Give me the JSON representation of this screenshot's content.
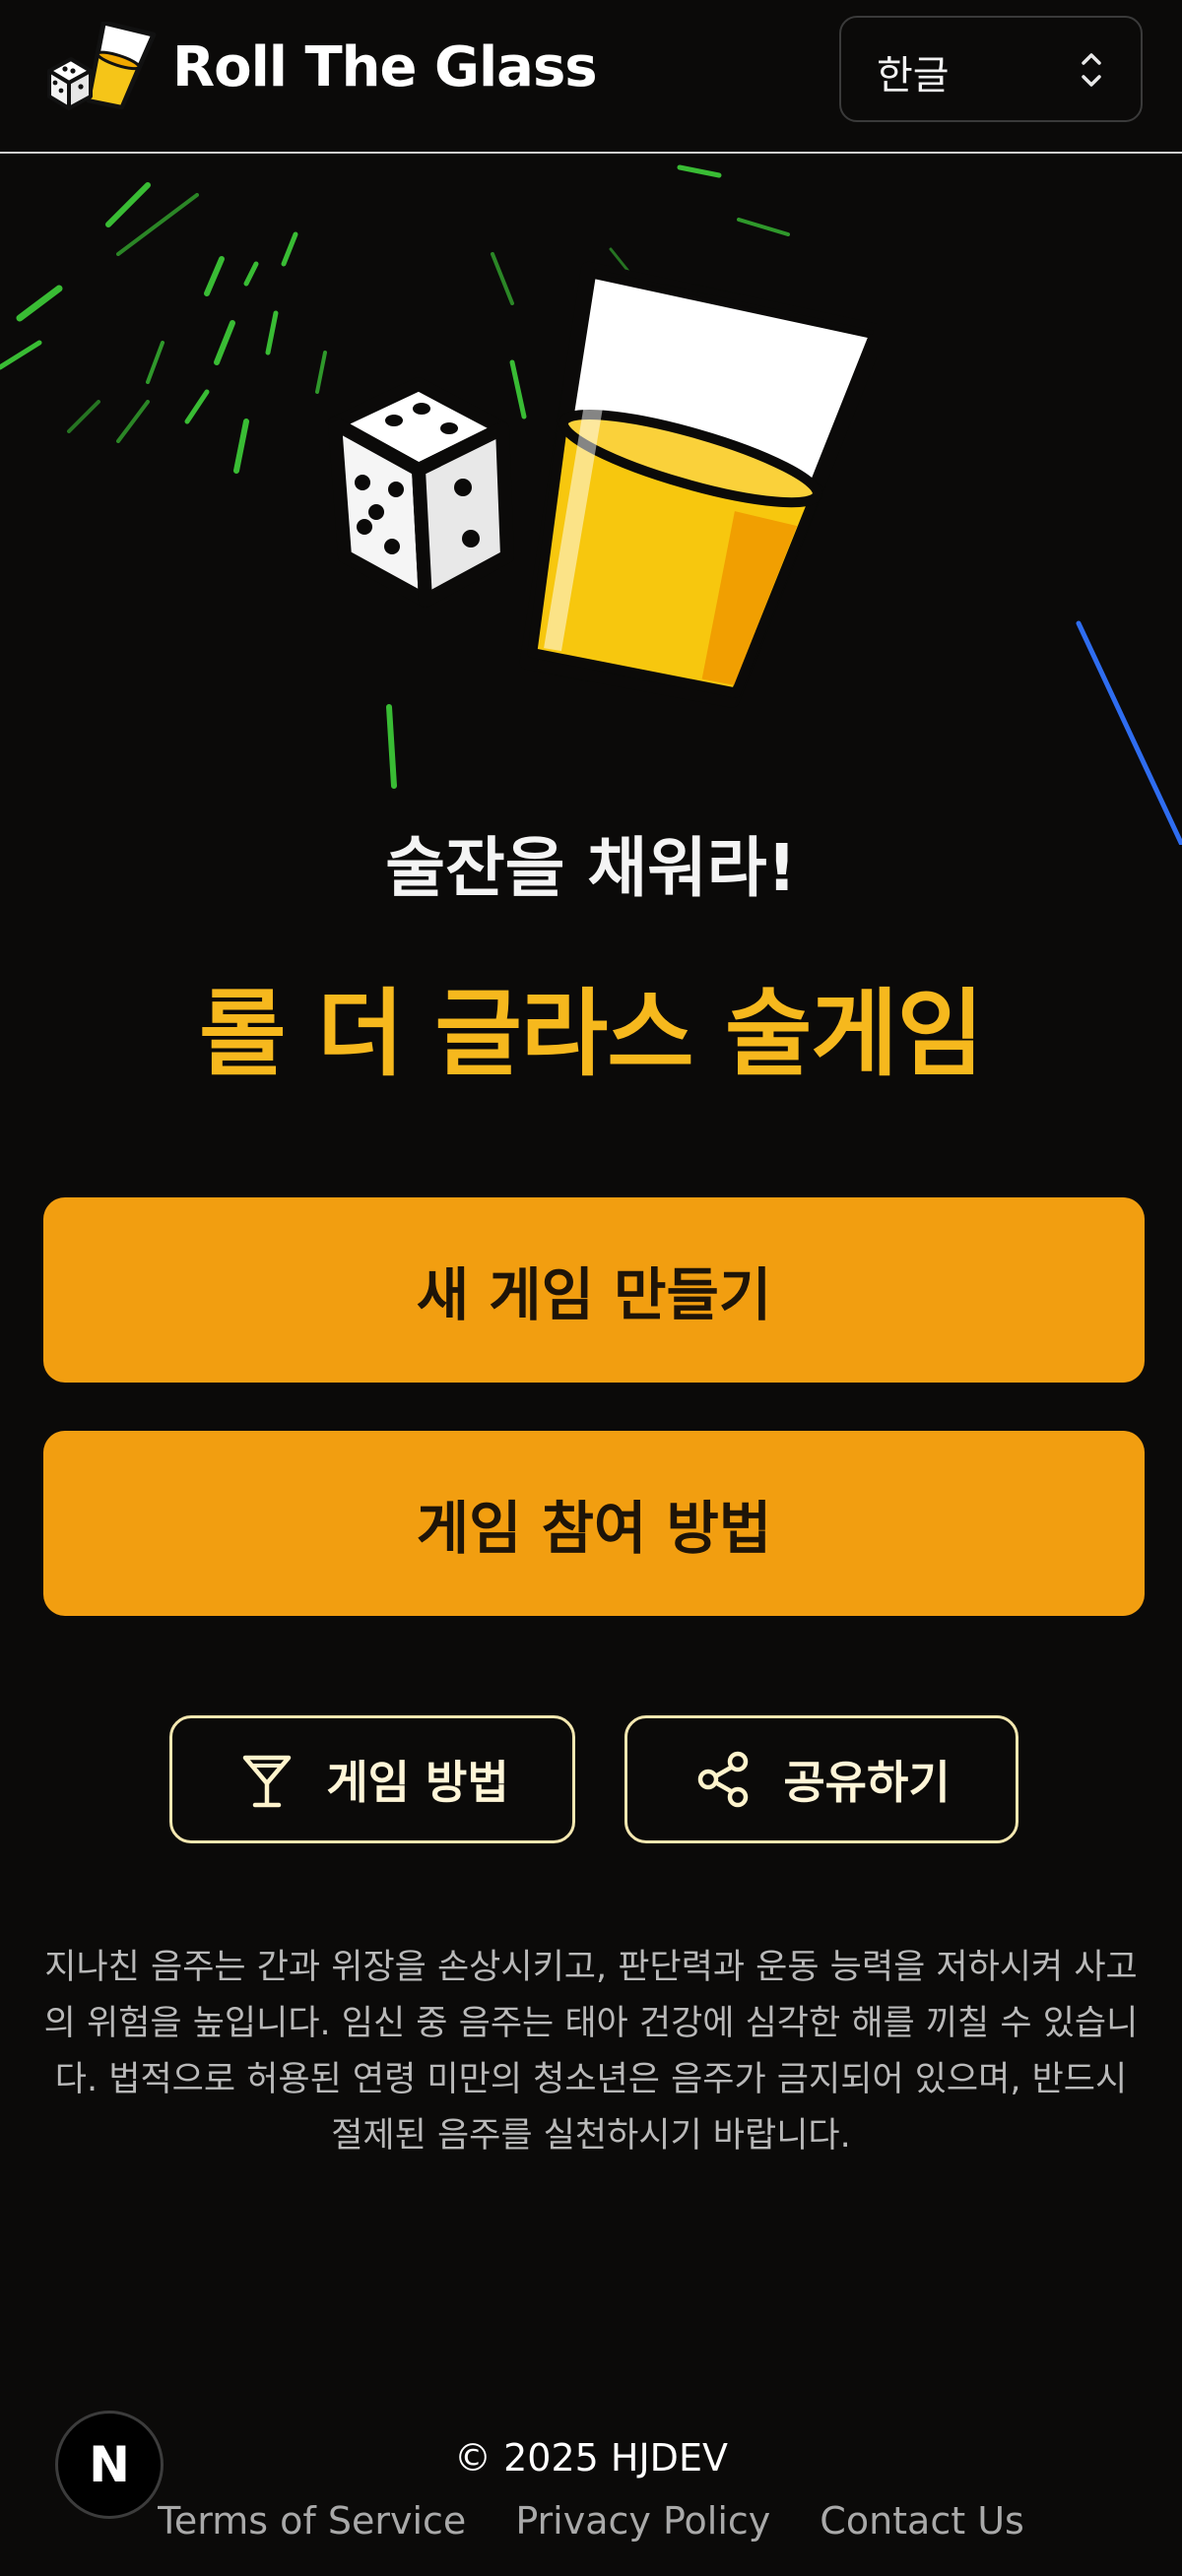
{
  "header": {
    "brand_name": "Roll The Glass",
    "language_selected": "한글"
  },
  "hero": {
    "tagline": "술잔을 채워라!",
    "title": "롤 더 글라스 술게임"
  },
  "actions": {
    "create_game": "새 게임 만들기",
    "join_guide": "게임 참여 방법",
    "how_to_play": "게임 방법",
    "share": "공유하기"
  },
  "warning": "지나친 음주는 간과 위장을 손상시키고, 판단력과 운동 능력을 저하시켜 사고의 위험을 높입니다. 임신 중 음주는 태아 건강에 심각한 해를 끼칠 수 있습니다. 법적으로 허용된 연령 미만의 청소년은 음주가 금지되어 있으며, 반드시 절제된 음주를 실천하시기 바랍니다.",
  "footer": {
    "badge": "N",
    "copyright": "© 2025 HJDEV",
    "links": [
      "Terms of Service",
      "Privacy Policy",
      "Contact Us"
    ]
  },
  "colors": {
    "background": "#0b0a09",
    "accent": "#f29e10",
    "title": "#f6b81d",
    "outline": "#f3e7b0"
  },
  "icons": {
    "logo": "dice-and-glass-logo",
    "hero": "dice-and-glass-illustration",
    "language": "chevron-updown-icon",
    "how_to_play": "cocktail-glass-icon",
    "share": "share-icon"
  }
}
